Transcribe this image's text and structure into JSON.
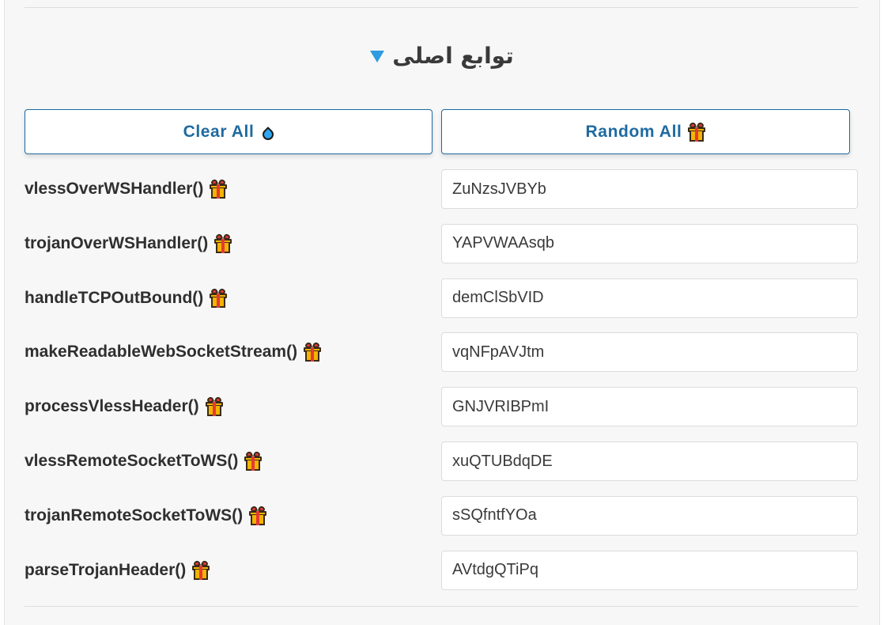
{
  "section": {
    "title": "توابع اصلی"
  },
  "buttons": {
    "clear_label": "Clear All",
    "random_label": "Random All"
  },
  "icons": {
    "clear": "droplet-icon",
    "random": "gift-icon",
    "row": "gift-icon"
  },
  "colors": {
    "accent": "#1e6aa0",
    "toggle": "#2f9be0"
  },
  "functions": [
    {
      "name": "vlessOverWSHandler()",
      "value": "ZuNzsJVBYb"
    },
    {
      "name": "trojanOverWSHandler()",
      "value": "YAPVWAAsqb"
    },
    {
      "name": "handleTCPOutBound()",
      "value": "demClSbVID"
    },
    {
      "name": "makeReadableWebSocketStream()",
      "value": "vqNFpAVJtm"
    },
    {
      "name": "processVlessHeader()",
      "value": "GNJVRIBPmI"
    },
    {
      "name": "vlessRemoteSocketToWS()",
      "value": "xuQTUBdqDE"
    },
    {
      "name": "trojanRemoteSocketToWS()",
      "value": "sSQfntfYOa"
    },
    {
      "name": "parseTrojanHeader()",
      "value": "AVtdgQTiPq"
    }
  ]
}
